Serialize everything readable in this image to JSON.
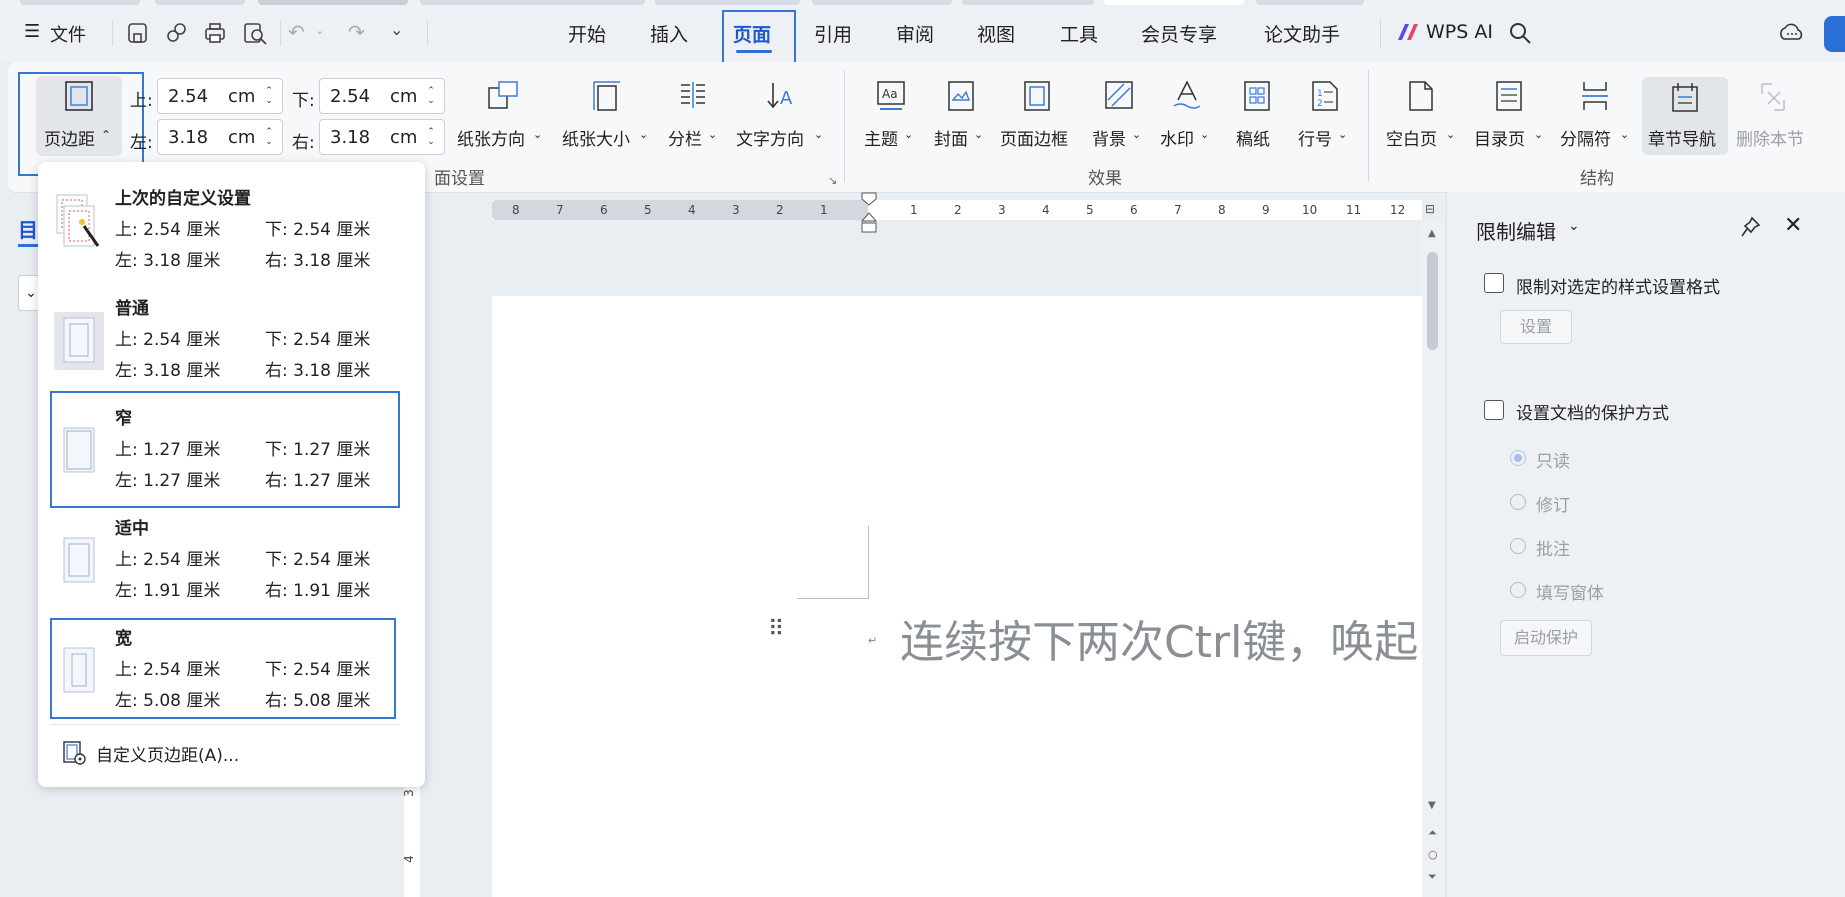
{
  "quick_access": {
    "file_label": "文件"
  },
  "menu_tabs": [
    "开始",
    "插入",
    "页面",
    "引用",
    "审阅",
    "视图",
    "工具",
    "会员专享",
    "论文助手"
  ],
  "active_tab": "页面",
  "wps_ai_label": "WPS AI",
  "ribbon": {
    "margins_label": "页边距",
    "top_label": "上:",
    "top_value": "2.54",
    "bottom_label": "下:",
    "bottom_value": "2.54",
    "left_label": "左:",
    "left_value": "3.18",
    "right_label": "右:",
    "right_value": "3.18",
    "unit": "cm",
    "orientation_label": "纸张方向",
    "size_label": "纸张大小",
    "columns_label": "分栏",
    "text_dir_label": "文字方向",
    "page_setup_group": "面设置",
    "theme_label": "主题",
    "cover_label": "封面",
    "border_label": "页面边框",
    "background_label": "背景",
    "watermark_label": "水印",
    "manuscript_label": "稿纸",
    "line_num_label": "行号",
    "effects_group": "效果",
    "blank_page_label": "空白页",
    "toc_label": "目录页",
    "separator_label": "分隔符",
    "section_nav_label": "章节导航",
    "delete_section_label": "删除本节",
    "structure_group": "结构"
  },
  "margin_presets": [
    {
      "title": "上次的自定义设置",
      "top": "上: 2.54 厘米",
      "bottom": "下: 2.54 厘米",
      "left": "左: 3.18 厘米",
      "right": "右: 3.18 厘米"
    },
    {
      "title": "普通",
      "top": "上: 2.54 厘米",
      "bottom": "下: 2.54 厘米",
      "left": "左: 3.18 厘米",
      "right": "右: 3.18 厘米"
    },
    {
      "title": "窄",
      "top": "上: 1.27 厘米",
      "bottom": "下: 1.27 厘米",
      "left": "左: 1.27 厘米",
      "right": "右: 1.27 厘米"
    },
    {
      "title": "适中",
      "top": "上: 2.54 厘米",
      "bottom": "下: 2.54 厘米",
      "left": "左: 1.91 厘米",
      "right": "右: 1.91 厘米"
    },
    {
      "title": "宽",
      "top": "上: 2.54 厘米",
      "bottom": "下: 2.54 厘米",
      "left": "左: 5.08 厘米",
      "right": "右: 5.08 厘米"
    }
  ],
  "custom_margins_label": "自定义页边距(A)...",
  "ruler": {
    "left_numbers": [
      "8",
      "7",
      "6",
      "5",
      "4",
      "3",
      "2",
      "1"
    ],
    "right_numbers": [
      "1",
      "2",
      "3",
      "4",
      "5",
      "6",
      "7",
      "8",
      "9",
      "10",
      "11",
      "12"
    ],
    "vertical_numbers": [
      "3",
      "4"
    ]
  },
  "document": {
    "placeholder": "连续按下两次Ctrl键，唤起W",
    "para_mark": "↵"
  },
  "left_nav": {
    "label": "目"
  },
  "panel": {
    "title": "限制编辑",
    "restrict_format_label": "限制对选定的样式设置格式",
    "settings_button": "设置",
    "protect_label": "设置文档的保护方式",
    "options": [
      "只读",
      "修订",
      "批注",
      "填写窗体"
    ],
    "start_button": "启动保护"
  },
  "colors": {
    "accent": "#2b6fd8",
    "highlight_border": "#3576d4"
  }
}
